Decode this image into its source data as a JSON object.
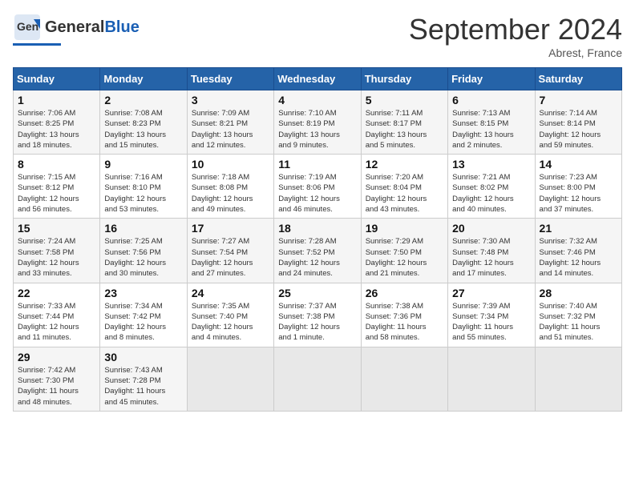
{
  "header": {
    "logo_general": "General",
    "logo_blue": "Blue",
    "month_title": "September 2024",
    "location": "Abrest, France"
  },
  "days_of_week": [
    "Sunday",
    "Monday",
    "Tuesday",
    "Wednesday",
    "Thursday",
    "Friday",
    "Saturday"
  ],
  "weeks": [
    [
      {
        "day": "1",
        "info": "Sunrise: 7:06 AM\nSunset: 8:25 PM\nDaylight: 13 hours\nand 18 minutes."
      },
      {
        "day": "2",
        "info": "Sunrise: 7:08 AM\nSunset: 8:23 PM\nDaylight: 13 hours\nand 15 minutes."
      },
      {
        "day": "3",
        "info": "Sunrise: 7:09 AM\nSunset: 8:21 PM\nDaylight: 13 hours\nand 12 minutes."
      },
      {
        "day": "4",
        "info": "Sunrise: 7:10 AM\nSunset: 8:19 PM\nDaylight: 13 hours\nand 9 minutes."
      },
      {
        "day": "5",
        "info": "Sunrise: 7:11 AM\nSunset: 8:17 PM\nDaylight: 13 hours\nand 5 minutes."
      },
      {
        "day": "6",
        "info": "Sunrise: 7:13 AM\nSunset: 8:15 PM\nDaylight: 13 hours\nand 2 minutes."
      },
      {
        "day": "7",
        "info": "Sunrise: 7:14 AM\nSunset: 8:14 PM\nDaylight: 12 hours\nand 59 minutes."
      }
    ],
    [
      {
        "day": "8",
        "info": "Sunrise: 7:15 AM\nSunset: 8:12 PM\nDaylight: 12 hours\nand 56 minutes."
      },
      {
        "day": "9",
        "info": "Sunrise: 7:16 AM\nSunset: 8:10 PM\nDaylight: 12 hours\nand 53 minutes."
      },
      {
        "day": "10",
        "info": "Sunrise: 7:18 AM\nSunset: 8:08 PM\nDaylight: 12 hours\nand 49 minutes."
      },
      {
        "day": "11",
        "info": "Sunrise: 7:19 AM\nSunset: 8:06 PM\nDaylight: 12 hours\nand 46 minutes."
      },
      {
        "day": "12",
        "info": "Sunrise: 7:20 AM\nSunset: 8:04 PM\nDaylight: 12 hours\nand 43 minutes."
      },
      {
        "day": "13",
        "info": "Sunrise: 7:21 AM\nSunset: 8:02 PM\nDaylight: 12 hours\nand 40 minutes."
      },
      {
        "day": "14",
        "info": "Sunrise: 7:23 AM\nSunset: 8:00 PM\nDaylight: 12 hours\nand 37 minutes."
      }
    ],
    [
      {
        "day": "15",
        "info": "Sunrise: 7:24 AM\nSunset: 7:58 PM\nDaylight: 12 hours\nand 33 minutes."
      },
      {
        "day": "16",
        "info": "Sunrise: 7:25 AM\nSunset: 7:56 PM\nDaylight: 12 hours\nand 30 minutes."
      },
      {
        "day": "17",
        "info": "Sunrise: 7:27 AM\nSunset: 7:54 PM\nDaylight: 12 hours\nand 27 minutes."
      },
      {
        "day": "18",
        "info": "Sunrise: 7:28 AM\nSunset: 7:52 PM\nDaylight: 12 hours\nand 24 minutes."
      },
      {
        "day": "19",
        "info": "Sunrise: 7:29 AM\nSunset: 7:50 PM\nDaylight: 12 hours\nand 21 minutes."
      },
      {
        "day": "20",
        "info": "Sunrise: 7:30 AM\nSunset: 7:48 PM\nDaylight: 12 hours\nand 17 minutes."
      },
      {
        "day": "21",
        "info": "Sunrise: 7:32 AM\nSunset: 7:46 PM\nDaylight: 12 hours\nand 14 minutes."
      }
    ],
    [
      {
        "day": "22",
        "info": "Sunrise: 7:33 AM\nSunset: 7:44 PM\nDaylight: 12 hours\nand 11 minutes."
      },
      {
        "day": "23",
        "info": "Sunrise: 7:34 AM\nSunset: 7:42 PM\nDaylight: 12 hours\nand 8 minutes."
      },
      {
        "day": "24",
        "info": "Sunrise: 7:35 AM\nSunset: 7:40 PM\nDaylight: 12 hours\nand 4 minutes."
      },
      {
        "day": "25",
        "info": "Sunrise: 7:37 AM\nSunset: 7:38 PM\nDaylight: 12 hours\nand 1 minute."
      },
      {
        "day": "26",
        "info": "Sunrise: 7:38 AM\nSunset: 7:36 PM\nDaylight: 11 hours\nand 58 minutes."
      },
      {
        "day": "27",
        "info": "Sunrise: 7:39 AM\nSunset: 7:34 PM\nDaylight: 11 hours\nand 55 minutes."
      },
      {
        "day": "28",
        "info": "Sunrise: 7:40 AM\nSunset: 7:32 PM\nDaylight: 11 hours\nand 51 minutes."
      }
    ],
    [
      {
        "day": "29",
        "info": "Sunrise: 7:42 AM\nSunset: 7:30 PM\nDaylight: 11 hours\nand 48 minutes."
      },
      {
        "day": "30",
        "info": "Sunrise: 7:43 AM\nSunset: 7:28 PM\nDaylight: 11 hours\nand 45 minutes."
      },
      null,
      null,
      null,
      null,
      null
    ]
  ]
}
